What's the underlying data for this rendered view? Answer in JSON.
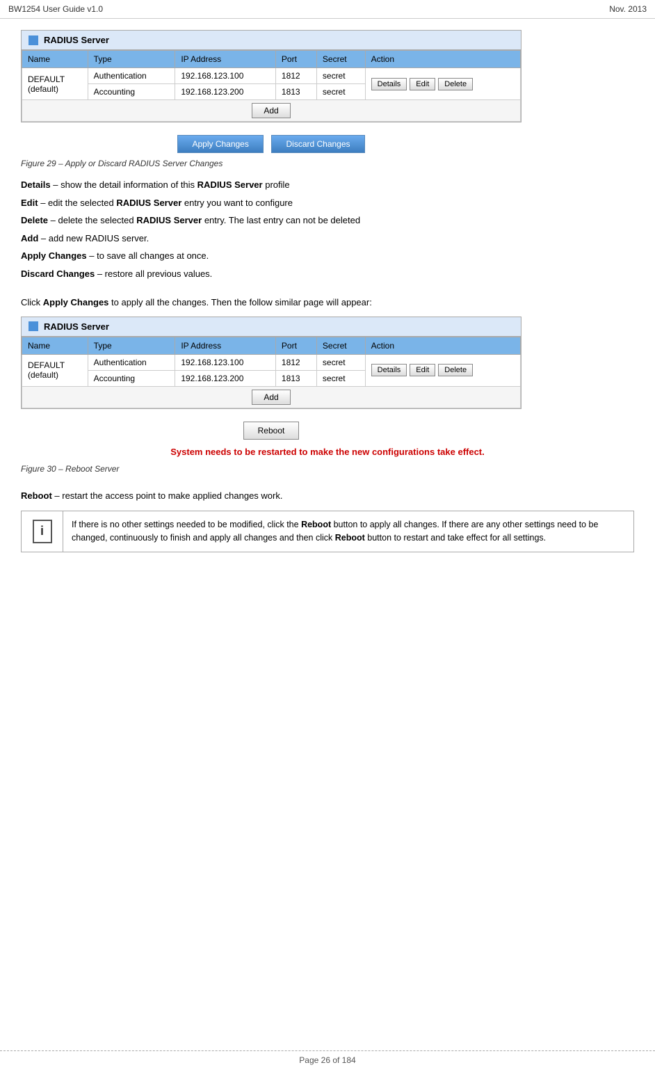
{
  "header": {
    "left": "BW1254 User Guide v1.0",
    "right": "Nov.  2013"
  },
  "footer": {
    "text": "Page 26 of 184"
  },
  "figure1": {
    "caption": "Figure 29 – Apply or Discard RADIUS Server Changes"
  },
  "figure2": {
    "caption": "Figure 30 – Reboot Server"
  },
  "radius_widget_title": "RADIUS Server",
  "table": {
    "columns": [
      "Name",
      "Type",
      "IP Address",
      "Port",
      "Secret",
      "Action"
    ],
    "row_name": "DEFAULT\n(default)",
    "rows": [
      {
        "type": "Authentication",
        "ip": "192.168.123.100",
        "port": "1812",
        "secret": "secret"
      },
      {
        "type": "Accounting",
        "ip": "192.168.123.200",
        "port": "1813",
        "secret": "secret"
      }
    ],
    "add_button": "Add",
    "details_button": "Details",
    "edit_button": "Edit",
    "delete_button": "Delete"
  },
  "buttons": {
    "apply": "Apply Changes",
    "discard": "Discard Changes",
    "reboot": "Reboot"
  },
  "descriptions": [
    {
      "id": "details",
      "label": "Details",
      "text": " – show the detail information of this ",
      "bold_mid": "RADIUS Server",
      "text2": " profile"
    },
    {
      "id": "edit",
      "label": "Edit",
      "text": " – edit the selected ",
      "bold_mid": "RADIUS Server",
      "text2": " entry you want to configure"
    },
    {
      "id": "delete",
      "label": "Delete",
      "text": " – delete the selected ",
      "bold_mid": "RADIUS Server",
      "text2": " entry. The last entry can not be deleted"
    },
    {
      "id": "add",
      "label": "Add",
      "text": " – add new RADIUS server.",
      "bold_mid": "",
      "text2": ""
    },
    {
      "id": "apply_changes",
      "label": "Apply Changes",
      "text": " – to save all changes at once.",
      "bold_mid": "",
      "text2": ""
    },
    {
      "id": "discard_changes",
      "label": "Discard Changes",
      "text": " – restore all previous values.",
      "bold_mid": "",
      "text2": ""
    }
  ],
  "click_intro": "Click ",
  "click_bold": "Apply Changes",
  "click_rest": " to apply all the changes. Then the follow similar page will appear:",
  "system_msg": "System needs to be restarted to make the new configurations take effect.",
  "reboot_desc_label": "Reboot",
  "reboot_desc_text": " – restart the access point to make applied changes work.",
  "note": {
    "text": "If there is no other settings needed to be modified, click the ",
    "bold1": "Reboot",
    "text2": " button to apply all changes. If there are any other settings need to be changed, continuously to finish and apply all changes and then click ",
    "bold2": "Reboot",
    "text3": " button to restart and take effect for all settings."
  }
}
